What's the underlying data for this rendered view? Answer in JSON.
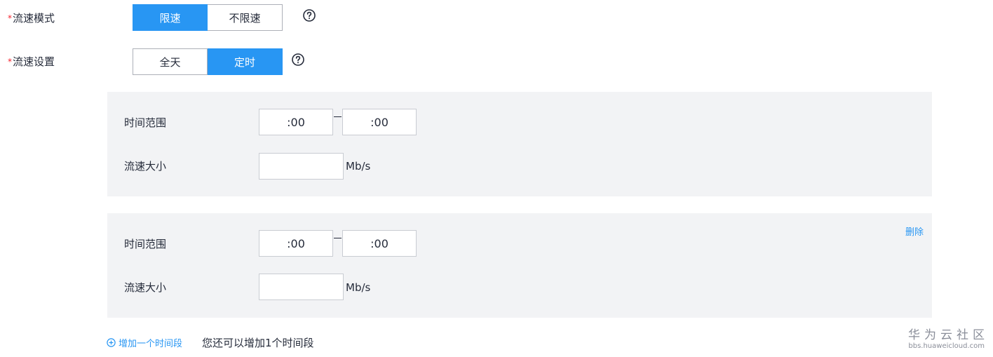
{
  "mode": {
    "label": "流速模式",
    "options": [
      "限速",
      "不限速"
    ],
    "selected": "限速"
  },
  "schedule": {
    "label": "流速设置",
    "options": [
      "全天",
      "定时"
    ],
    "selected": "定时"
  },
  "periods": [
    {
      "time_range_label": "时间范围",
      "start": ":00",
      "end": ":00",
      "rate_label": "流速大小",
      "rate_value": "",
      "unit": "Mb/s"
    },
    {
      "time_range_label": "时间范围",
      "start": ":00",
      "end": ":00",
      "rate_label": "流速大小",
      "rate_value": "",
      "unit": "Mb/s",
      "delete_label": "删除"
    }
  ],
  "add_period": {
    "label": "增加一个时间段",
    "hint": "您还可以增加1个时间段"
  },
  "watermark": {
    "title": "华为云社区",
    "url": "bbs.huaweicloud.com"
  },
  "colors": {
    "accent": "#2896f3",
    "required": "#f5222d",
    "panel_bg": "#f2f3f5"
  }
}
